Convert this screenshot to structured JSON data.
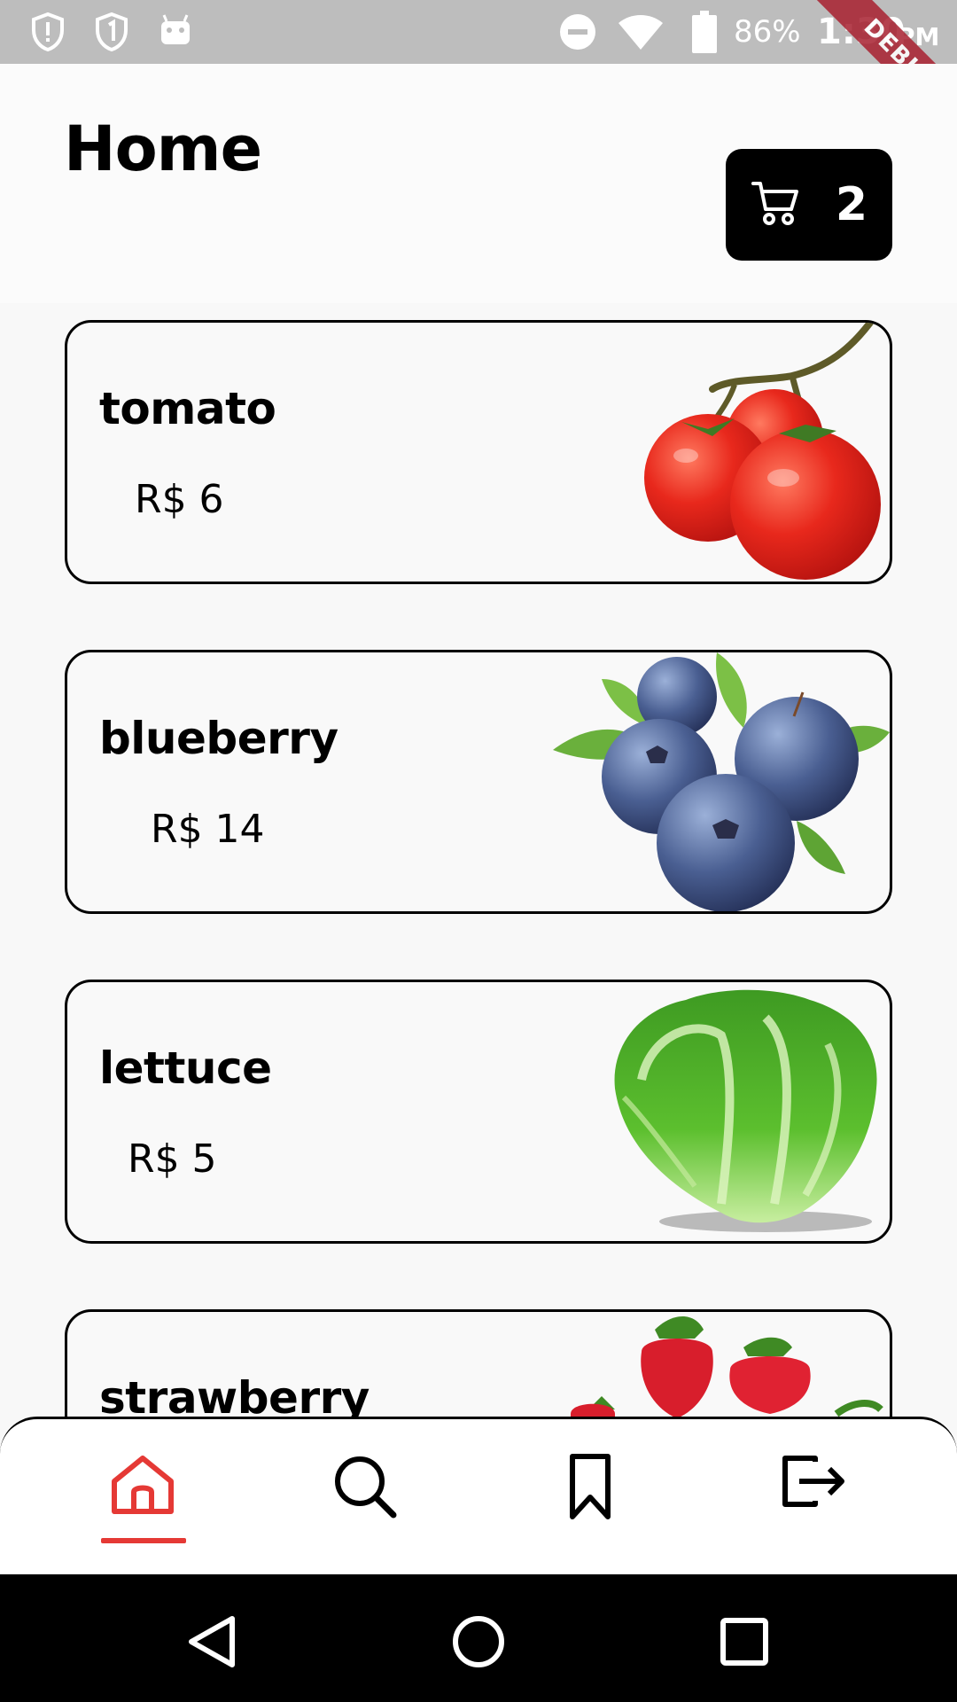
{
  "status_bar": {
    "battery": "86%",
    "time": "1:30",
    "ampm": "PM",
    "notification_icons": [
      "shield-alert-icon",
      "shield-one-icon",
      "android-icon"
    ],
    "system_icons": [
      "do-not-disturb-icon",
      "wifi-icon",
      "battery-icon"
    ]
  },
  "debug_banner": "DEBUG",
  "header": {
    "title": "Home",
    "cart": {
      "icon": "cart-icon",
      "count": "2"
    }
  },
  "products": [
    {
      "name": "tomato",
      "price": "R$ 6",
      "image": "tomato-image"
    },
    {
      "name": "blueberry",
      "price": "R$ 14",
      "image": "blueberry-image"
    },
    {
      "name": "lettuce",
      "price": "R$ 5",
      "image": "lettuce-image"
    },
    {
      "name": "strawberry",
      "price": "",
      "image": "strawberry-image"
    }
  ],
  "bottom_nav": {
    "items": [
      "home-icon",
      "search-icon",
      "bookmark-icon",
      "logout-icon"
    ],
    "active": "home-icon",
    "active_color": "#e53935"
  },
  "system_nav": [
    "back-icon",
    "home-circle-icon",
    "recents-icon"
  ]
}
